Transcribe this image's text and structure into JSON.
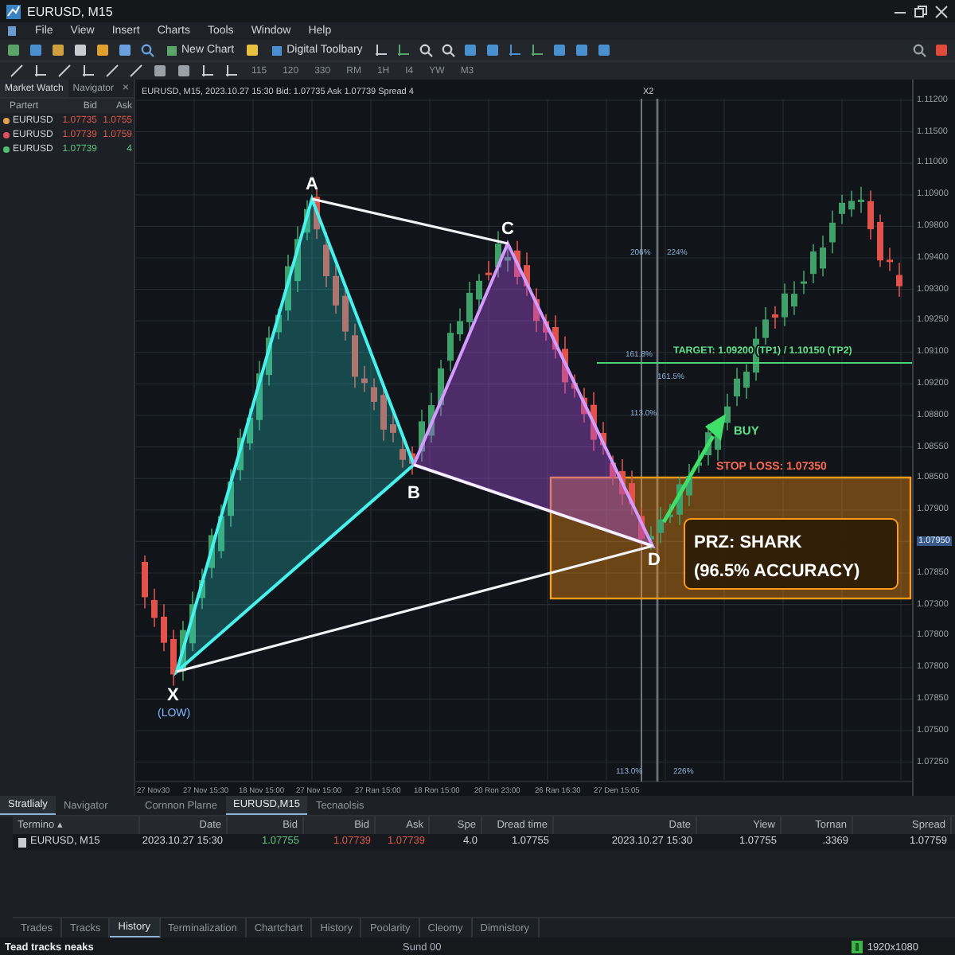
{
  "window": {
    "title": "EURUSD, M15"
  },
  "menu": [
    "File",
    "View",
    "Insert",
    "Charts",
    "Tools",
    "Window",
    "Help"
  ],
  "toolbar": {
    "new_chart": "New Chart",
    "digital_toolbar": "Digital Toolbary"
  },
  "timeframes": [
    "115",
    "120",
    "330",
    "RM",
    "1H",
    "I4",
    "YW",
    "M3"
  ],
  "market_watch": {
    "tabs": [
      {
        "label": "Market Watch",
        "selected": true
      },
      {
        "label": "Navigator",
        "selected": false
      }
    ],
    "close": "×",
    "columns": [
      "Partert",
      "Bid",
      "Ask"
    ],
    "rows": [
      {
        "symbol": "EURUSD",
        "bid": "1.07735",
        "ask": "1.0755",
        "color": "#e0a050",
        "kind": "down"
      },
      {
        "symbol": "EURUSD",
        "bid": "1.07739",
        "ask": "1.0759",
        "color": "#e05060",
        "kind": "down"
      },
      {
        "symbol": "EURUSD",
        "bid": "1.07739",
        "ask": "4",
        "color": "#50c070",
        "kind": "up"
      }
    ]
  },
  "chart": {
    "header": "EURUSD, M15, 2023.10.27 15:30 Bid: 1.07735 Ask 1.07739 Spread 4",
    "marker": "X2",
    "price_labels": [
      {
        "text": "1.11200",
        "current": false
      },
      {
        "text": "1.11500",
        "current": false
      },
      {
        "text": "1.11000",
        "current": false
      },
      {
        "text": "1.10900",
        "current": false
      },
      {
        "text": "1.09800",
        "current": false
      },
      {
        "text": "1.09400",
        "current": false
      },
      {
        "text": "1.09300",
        "current": false
      },
      {
        "text": "1.09250",
        "current": false
      },
      {
        "text": "1.09100",
        "current": false
      },
      {
        "text": "1.09200",
        "current": false
      },
      {
        "text": "1.08800",
        "current": false
      },
      {
        "text": "1.08550",
        "current": false
      },
      {
        "text": "1.08500",
        "current": false
      },
      {
        "text": "1.07900",
        "current": false
      },
      {
        "text": "1.07950",
        "current": true
      },
      {
        "text": "1.07850",
        "current": false
      },
      {
        "text": "1.07300",
        "current": false
      },
      {
        "text": "1.07800",
        "current": false
      },
      {
        "text": "1.07800",
        "current": false
      },
      {
        "text": "1.07850",
        "current": false
      },
      {
        "text": "1.07500",
        "current": false
      },
      {
        "text": "1.07250",
        "current": false
      }
    ],
    "time_labels": [
      "27 Nov30",
      "27 Nov 15:30",
      "18 Nov 15:00",
      "27 Nov 15:00",
      "27 Ran 15:00",
      "18 Ron 15:00",
      "20 Ron 23:00",
      "26 Ran 16:30",
      "27 Den 15:05"
    ],
    "fib_labels": [
      "206%",
      "224%",
      "161.8%",
      "161.5%",
      "113.0%",
      "113.0%",
      "226%"
    ],
    "points": [
      {
        "label": "X",
        "note": "(LOW)"
      },
      {
        "label": "A"
      },
      {
        "label": "B"
      },
      {
        "label": "C"
      },
      {
        "label": "D"
      }
    ],
    "target": "TARGET: 1.09200 (TP1) / 1.10150 (TP2)",
    "signal": "BUY",
    "stop_loss": "STOP LOSS: 1.07350",
    "prz": [
      "PRZ: SHARK",
      "(96.5% ACCURACY)"
    ]
  },
  "left_tabs": [
    {
      "label": "Stratlialy",
      "selected": true
    },
    {
      "label": "Navigator",
      "selected": false
    }
  ],
  "chart_tabs": [
    {
      "label": "Cornnon Plarne",
      "selected": false
    },
    {
      "label": "EURUSD,M15",
      "selected": true
    },
    {
      "label": "Tecnaolsis",
      "selected": false
    }
  ],
  "table": {
    "columns": [
      "Termino ▴",
      "Date",
      "Bid",
      "Bid",
      "Ask",
      "Spe",
      "Dread time",
      "Date",
      "Yiew",
      "Tornan",
      "Spread"
    ],
    "rows": [
      {
        "cells": [
          {
            "text": "EURUSD, M15",
            "kind": "plain"
          },
          {
            "text": "2023.10.27 15:30",
            "kind": "plain"
          },
          {
            "text": "1.07755",
            "kind": "up"
          },
          {
            "text": "1.07739",
            "kind": "down"
          },
          {
            "text": "1.07739",
            "kind": "down"
          },
          {
            "text": "4.0",
            "kind": "plain"
          },
          {
            "text": "1.07755",
            "kind": "plain"
          },
          {
            "text": "2023.10.27 15:30",
            "kind": "plain"
          },
          {
            "text": "1.07755",
            "kind": "plain"
          },
          {
            "text": ".3369",
            "kind": "plain"
          },
          {
            "text": "1.07759",
            "kind": "plain"
          }
        ]
      }
    ]
  },
  "bottom_tabs": [
    {
      "label": "Trades",
      "selected": false
    },
    {
      "label": "Tracks",
      "selected": false
    },
    {
      "label": "History",
      "selected": true
    },
    {
      "label": "Terminalization",
      "selected": false
    },
    {
      "label": "Chartchart",
      "selected": false
    },
    {
      "label": "History",
      "selected": false
    },
    {
      "label": "Poolarity",
      "selected": false
    },
    {
      "label": "Cleomy",
      "selected": false
    },
    {
      "label": "Dimnistory",
      "selected": false
    }
  ],
  "status_bar": {
    "message": "Tead tracks neaks",
    "center": "Sund 00",
    "resolution": "1920x1080"
  }
}
